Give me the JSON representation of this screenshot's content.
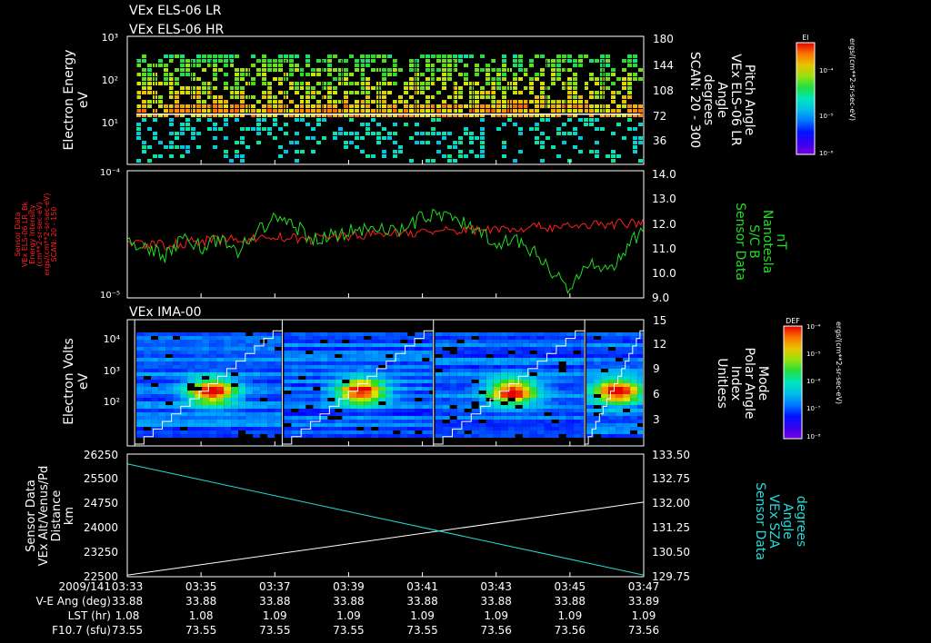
{
  "page": {
    "colors": {
      "background": "#000000",
      "frame": "#ffffff",
      "red": "#ff2020",
      "green": "#22dd22",
      "cyan": "#22dddd"
    }
  },
  "titles": {
    "lr": "VEx ELS-06 LR",
    "hr": "VEx ELS-06 HR",
    "ima": "VEx IMA-00"
  },
  "panel1": {
    "ylabel": [
      "Electron Energy",
      "eV"
    ],
    "yticks": [
      "10³",
      "10²",
      "10¹"
    ],
    "yticks_right": [
      "180",
      "144",
      "108",
      "72",
      "36"
    ],
    "rlabel": [
      "Pitch Angle",
      "VEx ELS-06 LR",
      "Angle",
      "degrees",
      "SCAN: 20 - 300"
    ],
    "colorbar": {
      "title": "El",
      "ticks": [
        "10⁻⁴",
        "10⁻⁵",
        "10⁻⁶"
      ],
      "label": "ergs/(cm**2-sr-sec-eV)"
    }
  },
  "panel2": {
    "ylabel": [
      "Sensor Data",
      "VEx ELS-06 LR_Bk",
      "Energy Intensity",
      "(cm**2-sr-sec-eV)",
      "ergs/(cm**2-sr-sec-eV)",
      "SCAN: 20 - 150"
    ],
    "yticks": [
      "10⁻⁴",
      "10⁻⁵"
    ],
    "yticks_right": [
      "14.0",
      "13.0",
      "12.0",
      "11.0",
      "10.0",
      "9.0"
    ],
    "rlabel": [
      "Sensor Data",
      "S/C B",
      "Nanotesla",
      "nT"
    ]
  },
  "panel3": {
    "ylabel": [
      "Electron Volts",
      "eV"
    ],
    "yticks": [
      "10⁴",
      "10³",
      "10²"
    ],
    "yticks_right": [
      "15",
      "12",
      "9",
      "6",
      "3"
    ],
    "rlabel": [
      "Mode",
      "Polar Angle",
      "Index",
      "Unitless"
    ],
    "colorbar": {
      "title": "DEF",
      "ticks": [
        "10⁻⁴",
        "10⁻⁵",
        "10⁻⁶",
        "10⁻⁷",
        "10⁻⁸"
      ],
      "label": "ergs/(cm**2-sr-sec-eV)"
    }
  },
  "panel4": {
    "ylabel": [
      "Sensor Data",
      "VEx Alt/Venus/Pd",
      "Distance",
      "km"
    ],
    "yticks": [
      "26250",
      "25500",
      "24750",
      "24000",
      "23250",
      "22500"
    ],
    "yticks_right": [
      "133.50",
      "132.75",
      "132.00",
      "131.25",
      "130.50",
      "129.75"
    ],
    "rlabel": [
      "Sensor Data",
      "VEx SZA",
      "Angle",
      "degrees"
    ]
  },
  "footer": {
    "row_labels": [
      "2009/141",
      "V-E Ang (deg)",
      "LST (hr)",
      "F10.7 (sfu)"
    ],
    "times": [
      "03:33",
      "03:35",
      "03:37",
      "03:39",
      "03:41",
      "03:43",
      "03:45",
      "03:47"
    ],
    "ve_ang": [
      "33.88",
      "33.88",
      "33.88",
      "33.88",
      "33.88",
      "33.88",
      "33.88",
      "33.89"
    ],
    "lst": [
      "1.08",
      "1.08",
      "1.09",
      "1.09",
      "1.09",
      "1.09",
      "1.09",
      "1.09"
    ],
    "f107": [
      "73.55",
      "73.55",
      "73.55",
      "73.55",
      "73.55",
      "73.56",
      "73.56",
      "73.56"
    ]
  },
  "chart_data": [
    {
      "type": "heatmap",
      "title": "VEx ELS-06 LR / VEx ELS-06 HR",
      "x_range": [
        "03:33",
        "03:47"
      ],
      "ylabel": "Electron Energy (eV)",
      "y_scale": "log",
      "ylim": [
        1,
        1000
      ],
      "y2label": "Pitch Angle (degrees)",
      "y2lim": [
        0,
        180
      ],
      "colorbar": "ergs/(cm**2-sr-sec-eV)",
      "colorbar_range": [
        1e-07,
        0.001
      ],
      "sweep_count": 27,
      "white_line_energy_eV": 15
    },
    {
      "type": "line",
      "xlim": [
        "03:33",
        "03:47"
      ],
      "y_scale": "log",
      "ylim": [
        1e-05,
        0.0001
      ],
      "y2lim": [
        9.0,
        14.0
      ],
      "series": [
        {
          "name": "VEx ELS-06 LR_Bk Energy Intensity",
          "axis": "left",
          "color": "#ff2020",
          "t": [
            0,
            1,
            2,
            3,
            4,
            5,
            6,
            7,
            8,
            9,
            10,
            11,
            12,
            13,
            14
          ],
          "values": [
            2.7e-05,
            2.6e-05,
            2.8e-05,
            2.9e-05,
            3e-05,
            2.9e-05,
            3.1e-05,
            3.2e-05,
            3.3e-05,
            3.4e-05,
            3.5e-05,
            3.6e-05,
            3.7e-05,
            3.8e-05,
            3.9e-05
          ]
        },
        {
          "name": "S/C B",
          "axis": "right",
          "color": "#22dd22",
          "t": [
            0,
            0.5,
            1,
            1.5,
            2,
            2.5,
            3,
            3.5,
            4,
            4.5,
            5,
            5.5,
            6,
            6.5,
            7,
            7.5,
            8,
            8.5,
            9,
            9.5,
            10,
            10.5,
            11,
            11.5,
            12,
            12.5,
            13,
            13.5,
            14
          ],
          "values": [
            11.2,
            11.0,
            10.6,
            11.4,
            11.0,
            11.3,
            10.8,
            11.6,
            12.1,
            11.9,
            11.3,
            11.5,
            11.6,
            11.7,
            11.8,
            11.6,
            12.2,
            12.3,
            12.0,
            11.7,
            11.2,
            11.3,
            10.8,
            10.1,
            9.4,
            10.3,
            10.0,
            10.9,
            11.7
          ]
        }
      ]
    },
    {
      "type": "heatmap",
      "title": "VEx IMA-00",
      "ylabel": "Electron Volts (eV)",
      "y_scale": "log",
      "ylim": [
        10,
        40000
      ],
      "y2label": "Polar Angle Index",
      "y2lim": [
        0,
        15
      ],
      "colorbar": "ergs/(cm**2-sr-sec-eV)",
      "colorbar_range": [
        1e-09,
        0.0001
      ],
      "scan_boundaries": [
        "03:33.2",
        "03:37.2",
        "03:41.3",
        "03:45.4"
      ],
      "peak_energy_eV": 400
    },
    {
      "type": "line",
      "xlim": [
        "03:33",
        "03:47"
      ],
      "ylim": [
        22500,
        26250
      ],
      "y2lim": [
        129.75,
        133.5
      ],
      "series": [
        {
          "name": "VEx Alt/Venus/Pd",
          "axis": "left",
          "color": "#ffffff",
          "t": [
            0,
            14
          ],
          "values": [
            22550,
            24780
          ]
        },
        {
          "name": "VEx SZA",
          "axis": "right",
          "color": "#22dddd",
          "t": [
            0,
            14
          ],
          "values": [
            133.2,
            129.8
          ]
        }
      ]
    }
  ]
}
